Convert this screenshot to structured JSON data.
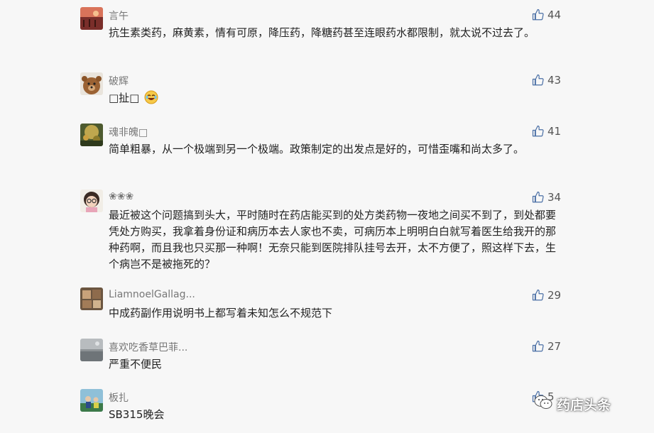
{
  "comments": [
    {
      "user": "言午",
      "text": "抗生素类药，麻黄素，情有可原，降压药，降糖药甚至连眼药水都限制，就太说不过去了。",
      "likes": "44"
    },
    {
      "user": "破辉",
      "text": "□扯□",
      "likes": "43"
    },
    {
      "user": "魂非魄□",
      "text": "简单粗暴，从一个极端到另一个极端。政策制定的出发点是好的，可惜歪嘴和尚太多了。",
      "likes": "41"
    },
    {
      "user": "❀❀❀",
      "text": "最近被这个问题搞到头大，平时随时在药店能买到的处方类药物一夜地之间买不到了，到处都要凭处方购买，我拿着身份证和病历本去人家也不卖，可病历本上明明白白就写着医生给我开的那种药啊，而且我也只买那一种啊！无奈只能到医院排队挂号去开，太不方便了，照这样下去，生个病岂不是被拖死的？",
      "likes": "34"
    },
    {
      "user": "LiamnoelGallag...",
      "text": "中成药副作用说明书上都写着未知怎么不规范下",
      "likes": "29"
    },
    {
      "user": "喜欢吃香草巴菲...",
      "text": "严重不便民",
      "likes": "27"
    },
    {
      "user": "板扎",
      "text": "SB315晚会",
      "likes": "5"
    }
  ],
  "watermark": {
    "label": "药店头条",
    "icon": "wechat-icon"
  },
  "emoji": {
    "icon": "laughing-emoji-icon"
  }
}
